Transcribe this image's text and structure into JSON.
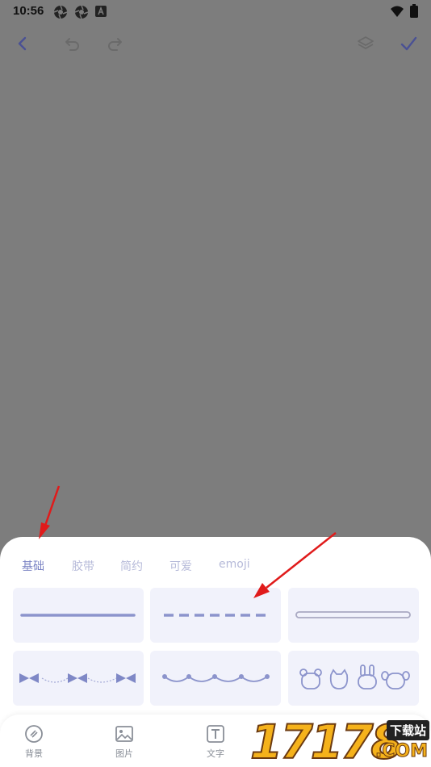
{
  "status_bar": {
    "time": "10:56"
  },
  "tabs": [
    {
      "label": "基础",
      "active": true
    },
    {
      "label": "胶带",
      "active": false
    },
    {
      "label": "简约",
      "active": false
    },
    {
      "label": "可爱",
      "active": false
    },
    {
      "label": "emoji",
      "active": false
    }
  ],
  "bottom_nav": [
    {
      "label": "背景",
      "icon": "background-icon"
    },
    {
      "label": "图片",
      "icon": "image-icon"
    },
    {
      "label": "文字",
      "icon": "text-icon"
    }
  ],
  "watermark": {
    "digits": "17178",
    "badge": "下载站",
    "domain": ".COM"
  },
  "colors": {
    "accent": "#7b84c4",
    "tab_inactive": "#b6bad9",
    "tile_bg": "#f1f2fb",
    "overlay": "#7d7d7d",
    "arrow": "#e01b1b"
  }
}
